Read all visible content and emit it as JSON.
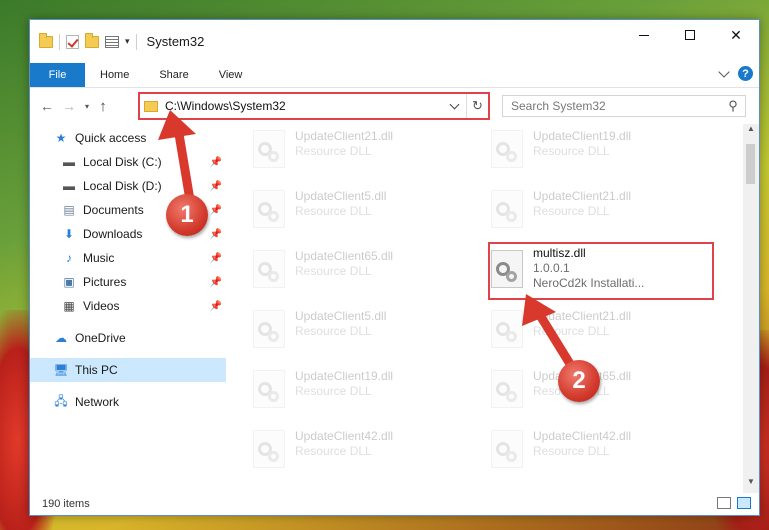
{
  "window": {
    "title": "System32",
    "controls": {
      "minimize": "minimize",
      "maximize": "maximize",
      "close": "✕"
    }
  },
  "ribbon": {
    "tabs": [
      "File",
      "Home",
      "Share",
      "View"
    ]
  },
  "nav": {
    "address": "C:\\Windows\\System32",
    "search_placeholder": "Search System32"
  },
  "sidebar": {
    "quick_access": "Quick access",
    "items": [
      {
        "label": "Local Disk (C:)",
        "icon": "drive-icon"
      },
      {
        "label": "Local Disk (D:)",
        "icon": "drive-icon"
      },
      {
        "label": "Documents",
        "icon": "documents-icon"
      },
      {
        "label": "Downloads",
        "icon": "downloads-icon"
      },
      {
        "label": "Music",
        "icon": "music-icon"
      },
      {
        "label": "Pictures",
        "icon": "pictures-icon"
      },
      {
        "label": "Videos",
        "icon": "videos-icon"
      }
    ],
    "onedrive": "OneDrive",
    "this_pc": "This PC",
    "network": "Network"
  },
  "files": [
    {
      "name": "UpdateClient21.dll",
      "type": "Resource DLL"
    },
    {
      "name": "UpdateClient19.dll",
      "type": "Resource DLL"
    },
    {
      "name": "UpdateClient5.dll",
      "type": "Resource DLL"
    },
    {
      "name": "UpdateClient21.dll",
      "type": "Resource DLL"
    },
    {
      "name": "UpdateClient65.dll",
      "type": "Resource DLL"
    },
    {
      "name": "multisz.dll",
      "version": "1.0.0.1",
      "description": "NeroCd2k Installati..."
    },
    {
      "name": "UpdateClient5.dll",
      "type": "Resource DLL"
    },
    {
      "name": "UpdateClient21.dll",
      "type": "Resource DLL"
    },
    {
      "name": "UpdateClient19.dll",
      "type": "Resource DLL"
    },
    {
      "name": "UpdateClient65.dll",
      "type": "Resource DLL"
    },
    {
      "name": "UpdateClient42.dll",
      "type": "Resource DLL"
    },
    {
      "name": "UpdateClient42.dll",
      "type": "Resource DLL"
    }
  ],
  "status": {
    "item_count": "190 items"
  },
  "callouts": {
    "step1": "1",
    "step2": "2"
  },
  "colors": {
    "accent": "#1979ca",
    "highlight": "#e0424a",
    "selected": "#cce8ff"
  }
}
